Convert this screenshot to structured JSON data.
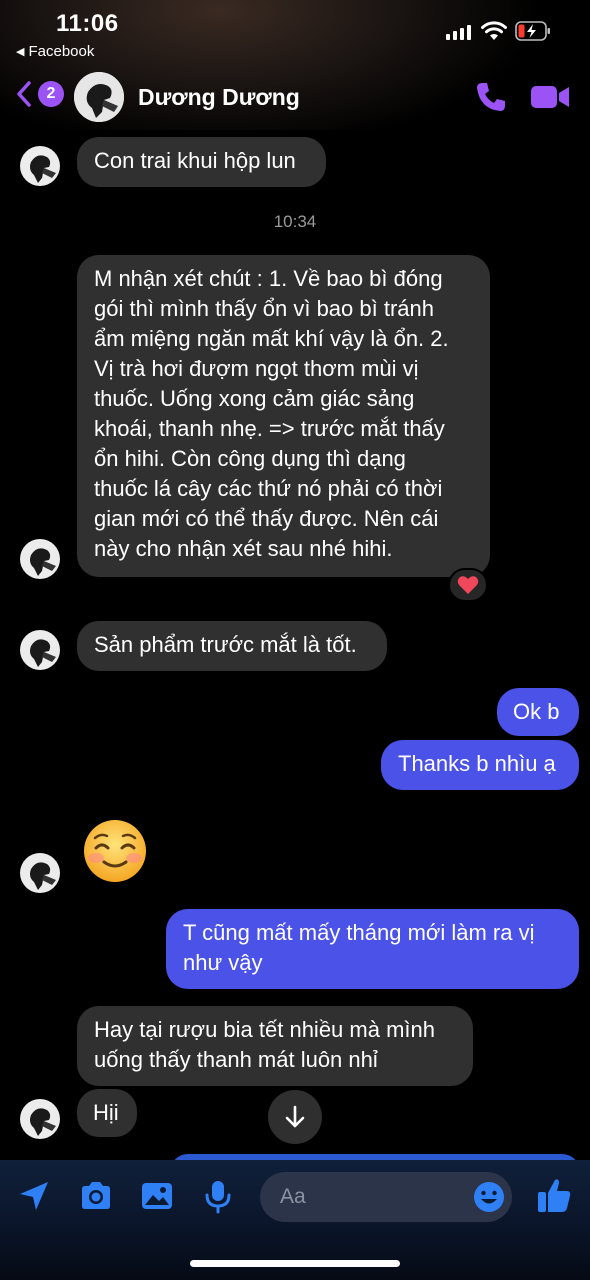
{
  "status_bar": {
    "time": "11:06",
    "back_app": "Facebook"
  },
  "header": {
    "unread_count": "2",
    "contact_name": "Dương Dương",
    "accent_color": "#9b53f5"
  },
  "messages": [
    {
      "side": "in",
      "text": "Con trai khui hộp lun"
    },
    {
      "type": "timestamp",
      "text": "10:34"
    },
    {
      "side": "in",
      "lines": [
        "M nhận xét chút : 1. Về bao bì đóng",
        "gói thì mình thấy ổn vì bao bì tránh",
        "ẩm miệng ngăn mất khí vậy là ổn. 2.",
        "Vị trà hơi đượm ngọt thơm mùi vị",
        "thuốc. Uống xong cảm giác sảng",
        "khoái, thanh nhẹ. => trước mắt thấy",
        "ổn hihi. Còn công dụng thì dạng",
        "thuốc lá cây các thứ nó phải có thời",
        "gian mới có thể thấy được. Nên cái",
        "này cho nhận xét sau nhé hihi."
      ],
      "reaction": "heart"
    },
    {
      "side": "in",
      "text": "Sản phẩm trước mắt là tốt."
    },
    {
      "side": "out",
      "text": "Ok b"
    },
    {
      "side": "out",
      "text": "Thanks b nhìu ạ"
    },
    {
      "side": "in",
      "emoji": "smiling-face-with-blush"
    },
    {
      "side": "out",
      "lines": [
        "T cũng mất mấy tháng mới làm ra vị",
        "như vậy"
      ]
    },
    {
      "side": "in",
      "lines": [
        "Hay tại rượu bia tết nhiều mà mình",
        "uống thấy thanh mát luôn nhỉ"
      ]
    },
    {
      "side": "in",
      "text": "Hịi"
    }
  ],
  "composer": {
    "placeholder": "Aa",
    "icons": [
      "location-arrow-icon",
      "camera-icon",
      "image-icon",
      "microphone-icon",
      "emoji-icon",
      "thumbs-up-icon"
    ]
  },
  "colors": {
    "incoming_bubble": "#303030",
    "outgoing_bubble": "#4a52e8",
    "icon_blue": "#2f7ff5"
  }
}
